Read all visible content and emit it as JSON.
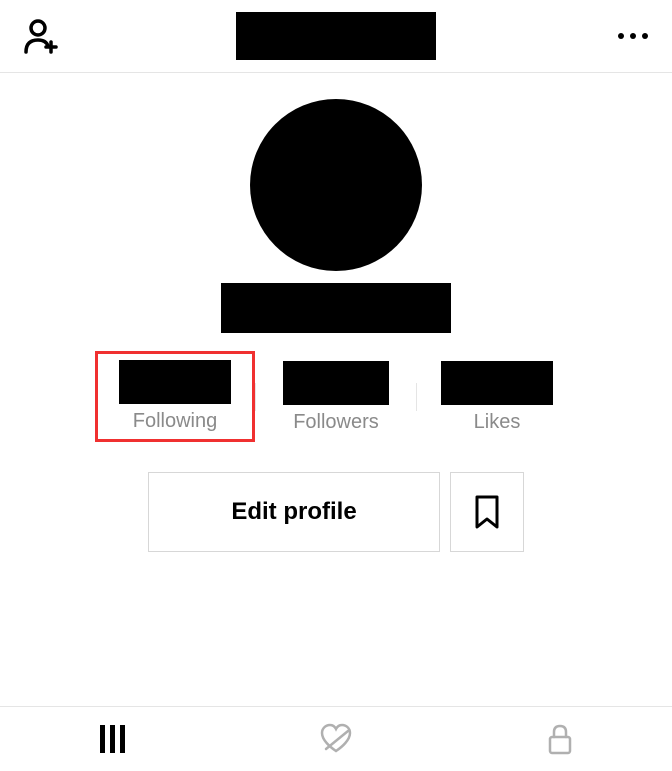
{
  "stats": {
    "following": {
      "label": "Following"
    },
    "followers": {
      "label": "Followers"
    },
    "likes": {
      "label": "Likes"
    }
  },
  "actions": {
    "edit_profile_label": "Edit profile"
  }
}
